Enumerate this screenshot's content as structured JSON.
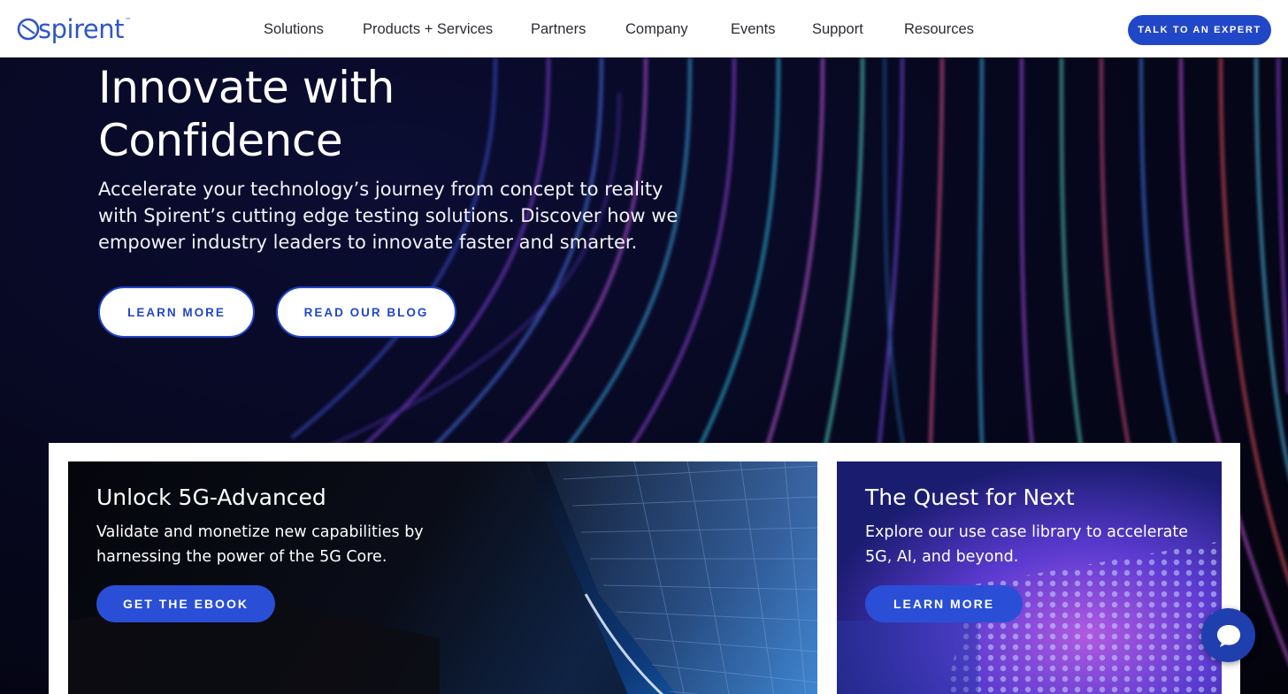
{
  "header": {
    "logo_text": "spirent",
    "logo_tm": "™",
    "nav": [
      {
        "label": "Solutions"
      },
      {
        "label": "Products + Services"
      },
      {
        "label": "Partners"
      },
      {
        "label": "Company"
      },
      {
        "label": "Events"
      },
      {
        "label": "Support"
      },
      {
        "label": "Resources"
      }
    ],
    "cta_label": "TALK TO AN EXPERT"
  },
  "hero": {
    "title_line1": "Innovate with",
    "title_line2": "Confidence",
    "subtitle": "Accelerate your technology’s journey from concept to reality with Spirent’s cutting edge testing solutions. Discover how we empower industry leaders to innovate faster and smarter.",
    "btn_learn_more": "LEARN MORE",
    "btn_read_blog": "READ OUR BLOG"
  },
  "cards": [
    {
      "title": "Unlock 5G-Advanced",
      "text": "Validate and monetize new capabilities by harnessing the power of the 5G Core.",
      "button": "GET THE EBOOK"
    },
    {
      "title": "The Quest for Next",
      "text": "Explore our use case library to accelerate 5G, AI, and beyond.",
      "button": "LEARN MORE"
    }
  ],
  "chat": {
    "icon": "chat-bubble-icon"
  },
  "colors": {
    "brand_blue": "#2147c9",
    "hero_bg": "#06071c",
    "header_bg": "#ffffff"
  }
}
